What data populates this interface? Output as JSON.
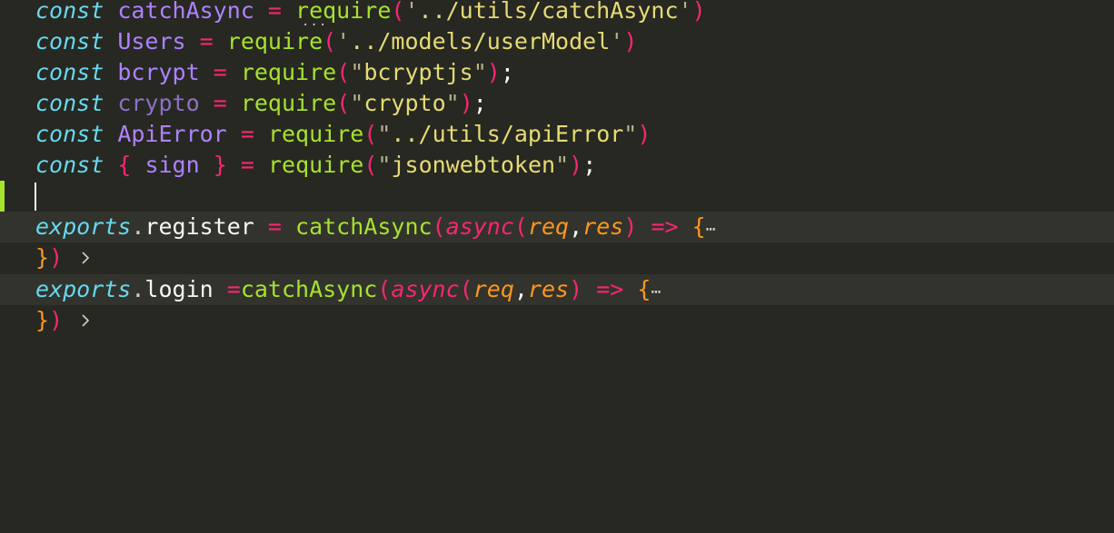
{
  "editor": {
    "lines": [
      {
        "kw": "const",
        "name": "catchAsync",
        "eq": "=",
        "fn": "require",
        "open": "(",
        "q1": "'",
        "path": "../utils/catchAsync",
        "q2": "'",
        "close": ")",
        "semi": ""
      },
      {
        "kw": "const",
        "name": "Users",
        "eq": "=",
        "fn": "require",
        "open": "(",
        "q1": "'",
        "path": "../models/userModel",
        "q2": "'",
        "close": ")",
        "semi": ""
      },
      {
        "kw": "const",
        "name": "bcrypt",
        "eq": "=",
        "fn": "require",
        "open": "(",
        "q1": "\"",
        "path": "bcryptjs",
        "q2": "\"",
        "close": ")",
        "semi": ";"
      },
      {
        "kw": "const",
        "name": "crypto",
        "eq": "=",
        "fn": "require",
        "open": "(",
        "q1": "\"",
        "path": "crypto",
        "q2": "\"",
        "close": ")",
        "semi": ";"
      },
      {
        "kw": "const",
        "name": "ApiError",
        "eq": "=",
        "fn": "require",
        "open": "(",
        "q1": "\"",
        "path": "../utils/apiError",
        "q2": "\"",
        "close": ")",
        "semi": ""
      },
      {
        "kw": "const",
        "lbrace": "{",
        "name": "sign",
        "rbrace": "}",
        "eq": "=",
        "fn": "require",
        "open": "(",
        "q1": "\"",
        "path": "jsonwebtoken",
        "q2": "\"",
        "close": ")",
        "semi": ";"
      }
    ],
    "register": {
      "obj": "exports",
      "dot": ".",
      "prop": "register",
      "eq": "=",
      "fn": "catchAsync",
      "open": "(",
      "async": "async",
      "open2": "(",
      "p1": "req",
      "comma": ",",
      "p2": "res",
      "close2": ")",
      "arrow": "=>",
      "brace": "{",
      "ellipsis": "⋯",
      "end_brace": "}",
      "end_paren": ")"
    },
    "login": {
      "obj": "exports",
      "dot": ".",
      "prop": "login",
      "eq": "=",
      "fn": "catchAsync",
      "open": "(",
      "async": "async",
      "open2": "(",
      "p1": "req",
      "comma": ",",
      "p2": "res",
      "close2": ")",
      "arrow": "=>",
      "brace": "{",
      "ellipsis": "⋯",
      "end_brace": "}",
      "end_paren": ")"
    },
    "hint_dots": "...",
    "colors": {
      "background": "#272822",
      "keyword": "#66d9ef",
      "variable": "#ae81ff",
      "operator": "#f92672",
      "function": "#a6e22e",
      "string": "#e6db74",
      "parameter": "#fd971f",
      "gutter_mark": "#a6e22e"
    },
    "icons": {
      "fold": "chevron-right-icon"
    }
  }
}
